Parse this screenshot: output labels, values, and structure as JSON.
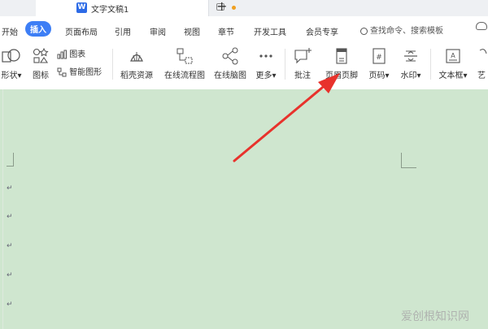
{
  "titlebar": {
    "doc_tab_title": "文字文稿1",
    "new_tab": "+"
  },
  "menubar": {
    "items": [
      "开始",
      "插入",
      "页面布局",
      "引用",
      "审阅",
      "视图",
      "章节",
      "开发工具",
      "会员专享"
    ],
    "active": "插入",
    "search_placeholder": "查找命令、搜索模板"
  },
  "ribbon": {
    "shapes": "形状",
    "icons": "图标",
    "chart": "图表",
    "smart_art": "智能图形",
    "stock_resources": "稻壳资源",
    "online_flowchart": "在线流程图",
    "online_mindmap": "在线脑图",
    "more": "更多",
    "comment": "批注",
    "header_footer": "页眉页脚",
    "page_number": "页码",
    "watermark": "水印",
    "textbox": "文本框",
    "art_text": "艺"
  },
  "document": {
    "paragraph_mark": "↵"
  },
  "overlay_watermark": "爱创根知识网",
  "colors": {
    "accent": "#3d7ef5",
    "doc_background": "#cfe6cf",
    "arrow": "#e8322c"
  }
}
